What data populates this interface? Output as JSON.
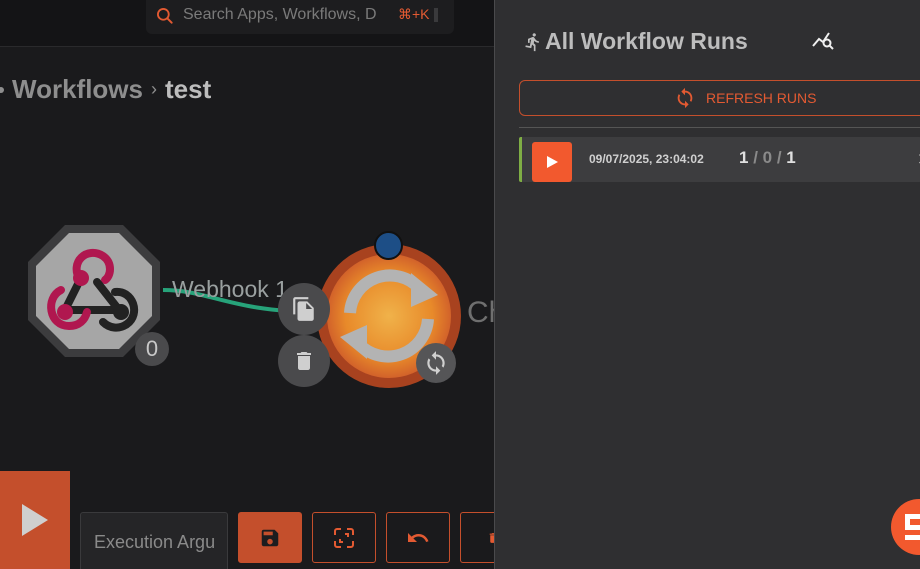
{
  "search": {
    "placeholder": "Search Apps, Workflows, D",
    "shortcut": "⌘+K",
    "icon": "search-icon"
  },
  "breadcrumb": {
    "parent": "Workflows",
    "separator": "›",
    "current": "test"
  },
  "canvas": {
    "webhook_label": "Webhook 1",
    "webhook_badge": "0",
    "action_label": "Ch",
    "edge_color": "#27a37a"
  },
  "toolbar": {
    "execution_args_placeholder": "Execution Argu",
    "icons": [
      "play-icon",
      "save-icon",
      "fullscreen-icon",
      "undo-icon",
      "delete-icon"
    ]
  },
  "panel": {
    "title": "All Workflow Runs",
    "refresh_label": "REFRESH RUNS",
    "runs": [
      {
        "timestamp": "09/07/2025, 23:04:02",
        "success": "1",
        "failed": "0",
        "total": "1",
        "status_color": "#7fae45"
      }
    ]
  },
  "colors": {
    "accent": "#f2592e",
    "background": "#1a1a1c",
    "panel": "#2f2f31"
  }
}
